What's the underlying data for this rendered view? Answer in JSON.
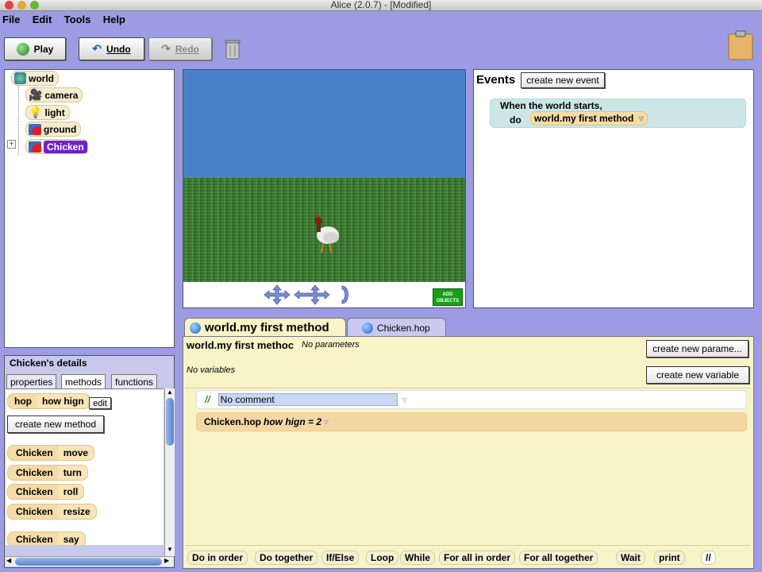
{
  "window": {
    "title": "Alice (2.0.7) -  [Modified]"
  },
  "menu": {
    "file": "File",
    "edit": "Edit",
    "tools": "Tools",
    "help": "Help"
  },
  "toolbar": {
    "play": "Play",
    "undo": "Undo",
    "redo": "Redo"
  },
  "tree": {
    "world": "world",
    "items": [
      "camera",
      "light",
      "ground",
      "Chicken"
    ],
    "expand": "+"
  },
  "world_view": {
    "add_objects": "ADD OBJECTS"
  },
  "events": {
    "title": "Events",
    "create_button": "create new event",
    "when": "When the world starts,",
    "do": "do",
    "method": "world.my first method"
  },
  "details": {
    "title": "Chicken's details",
    "tabs": [
      "properties",
      "methods",
      "functions"
    ],
    "hop": {
      "name": "hop",
      "param": "how hign",
      "edit": "edit"
    },
    "create_method": "create new method",
    "methods": [
      {
        "obj": "Chicken",
        "action": "move"
      },
      {
        "obj": "Chicken",
        "action": "turn"
      },
      {
        "obj": "Chicken",
        "action": "roll"
      },
      {
        "obj": "Chicken",
        "action": "resize"
      },
      {
        "obj": "Chicken",
        "action": "say"
      }
    ]
  },
  "editor": {
    "tabs": [
      "world.my first method",
      "Chicken.hop"
    ],
    "method_name": "world.my first methoc",
    "no_params": "No parameters",
    "no_vars": "No variables",
    "create_param": "create new parame...",
    "create_var": "create new variable",
    "comment_mark": "//",
    "comment_text": "No comment",
    "hop_call": "Chicken.hop",
    "hop_arg": "how hign = 2"
  },
  "controls": [
    "Do in order",
    "Do together",
    "If/Else",
    "Loop",
    "While",
    "For all in order",
    "For all together",
    "Wait",
    "print",
    "//"
  ]
}
